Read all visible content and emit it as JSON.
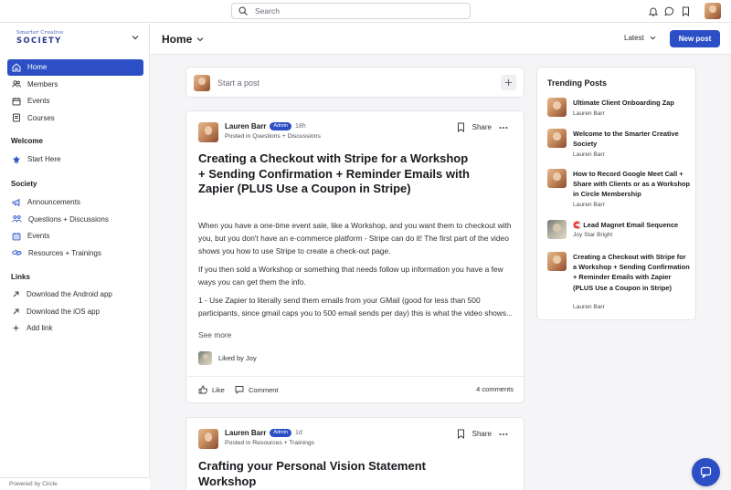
{
  "search": {
    "placeholder": "Search"
  },
  "brand": {
    "line1": "Smarter Creative",
    "line2": "SOCIETY"
  },
  "sidebar": {
    "main": [
      {
        "label": "Home",
        "icon": "home-icon",
        "active": true
      },
      {
        "label": "Members",
        "icon": "members-icon"
      },
      {
        "label": "Events",
        "icon": "calendar-icon"
      },
      {
        "label": "Courses",
        "icon": "course-icon"
      }
    ],
    "welcome_title": "Welcome",
    "welcome": [
      {
        "label": "Start Here",
        "icon": "star-pin-icon"
      }
    ],
    "society_title": "Society",
    "society": [
      {
        "label": "Announcements",
        "icon": "megaphone-icon"
      },
      {
        "label": "Questions + Discussions",
        "icon": "discussion-icon"
      },
      {
        "label": "Events",
        "icon": "calendar-icon"
      },
      {
        "label": "Resources + Trainings",
        "icon": "link-icon"
      }
    ],
    "links_title": "Links",
    "links": [
      {
        "label": "Download the Android app",
        "icon": "external-link-icon"
      },
      {
        "label": "Download the iOS app",
        "icon": "external-link-icon"
      },
      {
        "label": "Add link",
        "icon": "plus-icon"
      }
    ],
    "powered_by": "Powered by Circle"
  },
  "header": {
    "title": "Home",
    "sort_label": "Latest",
    "new_post_label": "New post"
  },
  "composer": {
    "placeholder": "Start a post"
  },
  "posts": [
    {
      "author": "Lauren Barr",
      "badge": "Admin",
      "time": "18h",
      "posted_in": "Posted in Questions + Discussions",
      "share_label": "Share",
      "title": "Creating a Checkout with Stripe for a Workshop + Sending Confirmation + Reminder Emails with Zapier (PLUS Use a Coupon in Stripe)",
      "body": [
        "When you have a one-time event sale, like a Workshop, and you want them to checkout with you, but you don't have an e-commerce platform - Stripe can do it! The first part of the video shows you how to use Stripe to create a check-out page.",
        "If you then sold a Workshop or something that needs follow up information you have a few ways you can get them the info.",
        "1 - Use Zapier to literally send them emails from your GMail (good for less than 500 participants, since gmail caps you to 500 email sends per day) this is what the video shows..."
      ],
      "see_more": "See more",
      "liked_by": "Liked by Joy",
      "like_label": "Like",
      "comment_label": "Comment",
      "comments_count": "4 comments"
    },
    {
      "author": "Lauren Barr",
      "badge": "Admin",
      "time": "1d",
      "posted_in": "Posted in Resources + Trainings",
      "share_label": "Share",
      "title": "Crafting your Personal Vision Statement Workshop"
    }
  ],
  "trending": {
    "title": "Trending Posts",
    "items": [
      {
        "title": "Ultimate Client Onboarding Zap",
        "author": "Lauren Barr"
      },
      {
        "title": "Welcome to the Smarter Creative Society",
        "author": "Lauren Barr"
      },
      {
        "title": "How to Record Google Meet Call + Share with Clients or as a Workshop in Circle Membership",
        "author": "Lauren Barr"
      },
      {
        "title": "🧲 Lead Magnet Email Sequence",
        "author": "Joy Star Bright"
      },
      {
        "title": "Creating a Checkout with Stripe for a Workshop + Sending Confirmation + Reminder Emails with Zapier (PLUS Use a Coupon in Stripe)",
        "author": "Lauren Barr"
      }
    ]
  },
  "colors": {
    "accent": "#2d4fc6",
    "background": "#f5f5f7"
  }
}
